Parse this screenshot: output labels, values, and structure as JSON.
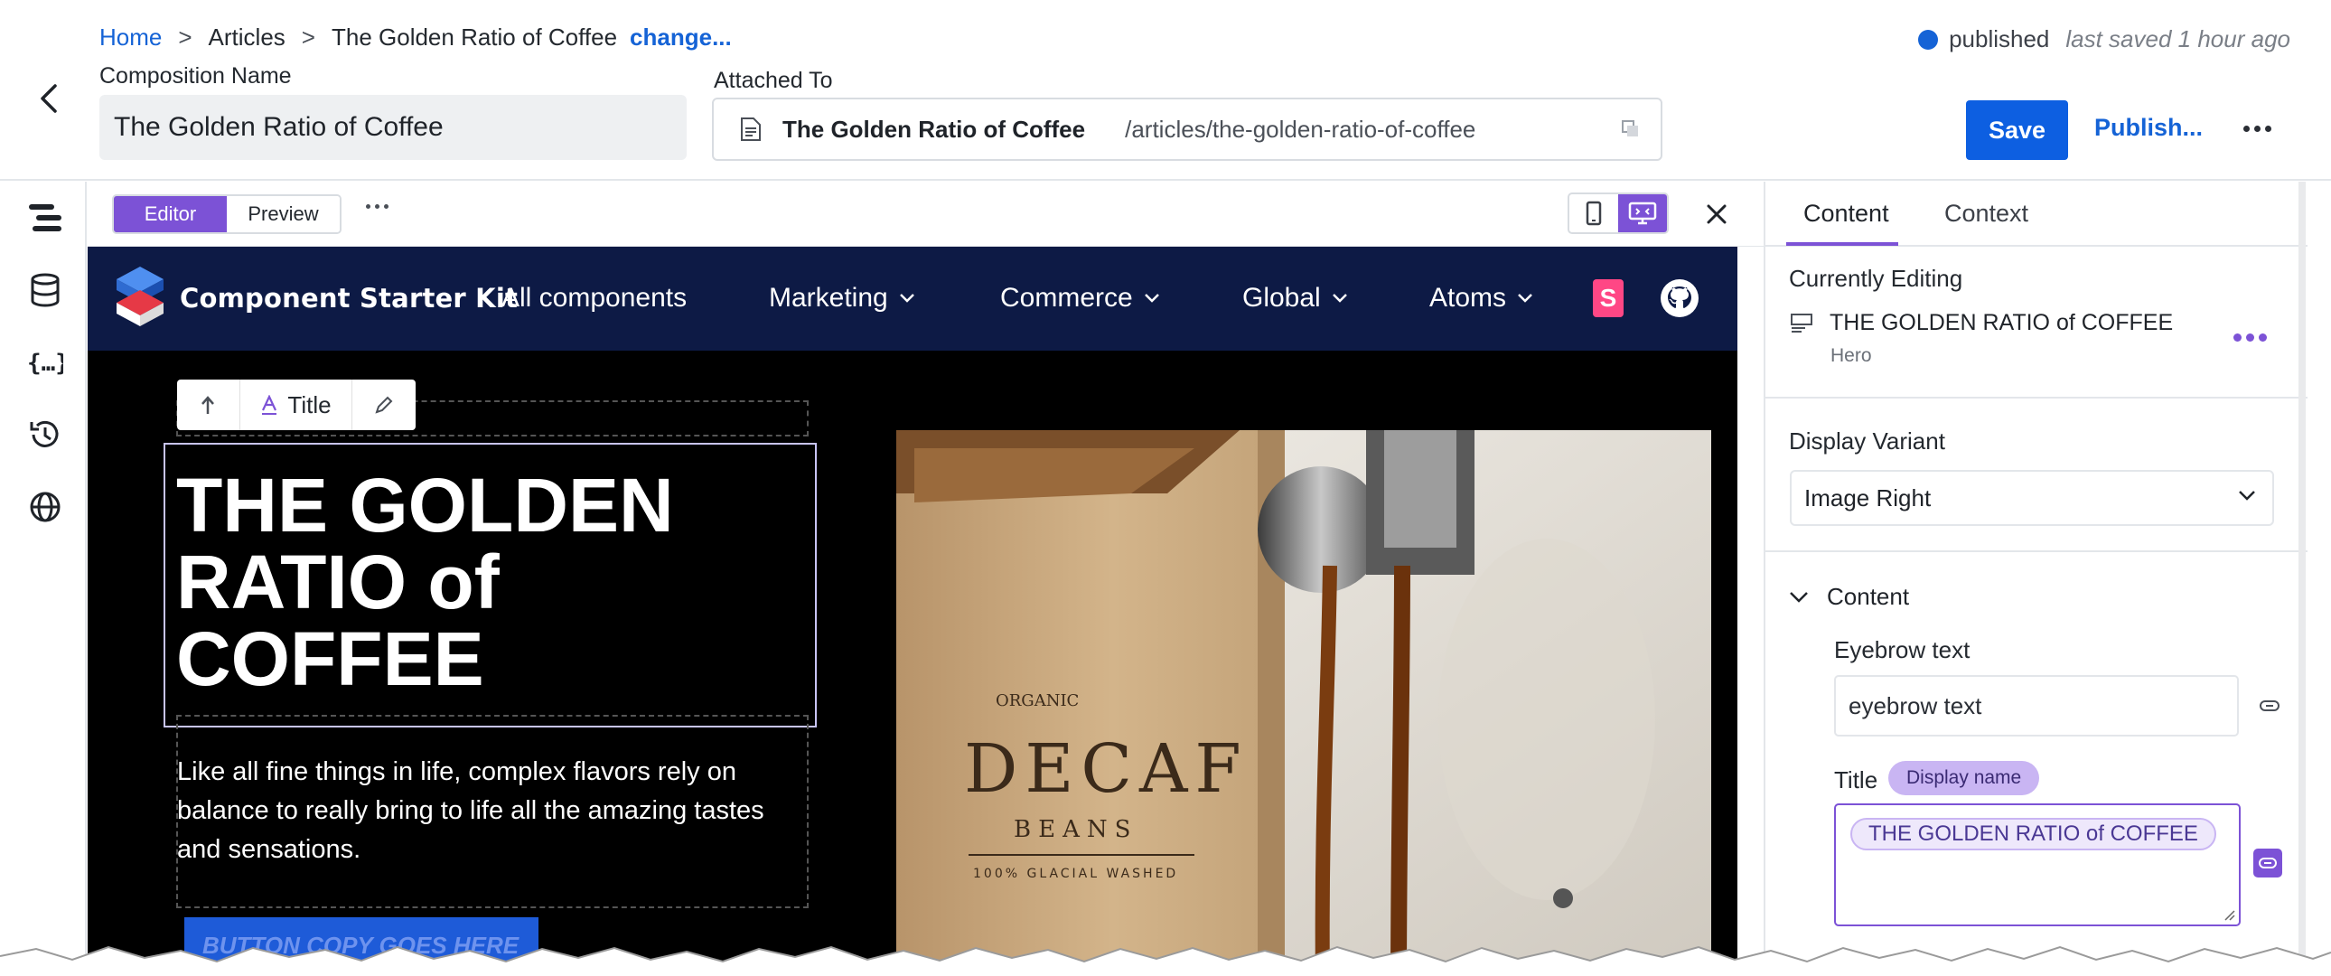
{
  "header": {
    "breadcrumb": {
      "home": "Home",
      "articles": "Articles",
      "current": "The Golden Ratio of Coffee",
      "change": "change...",
      "separator": ">"
    },
    "composition_name_label": "Composition Name",
    "composition_name_value": "The Golden Ratio of Coffee",
    "attached_to_label": "Attached To",
    "attached_title": "The Golden Ratio of Coffee",
    "attached_path": "/articles/the-golden-ratio-of-coffee",
    "status": "published",
    "last_saved": "last saved 1 hour ago",
    "save_label": "Save",
    "publish_label": "Publish..."
  },
  "editor_toolbar": {
    "editor_label": "Editor",
    "preview_label": "Preview"
  },
  "site": {
    "name": "Component Starter Kit",
    "nav": {
      "all": "All components",
      "marketing": "Marketing",
      "commerce": "Commerce",
      "global": "Global",
      "atoms": "Atoms"
    },
    "storybook_letter": "S"
  },
  "float_toolbar": {
    "title_label": "Title"
  },
  "hero": {
    "title": "THE GOLDEN RATIO of COFFEE",
    "description": "Like all fine things in life, complex flavors rely on balance to really bring to life all the amazing tastes and sensations.",
    "cta": "BUTTON COPY GOES HERE",
    "bag_text_top": "ORGANIC",
    "bag_text_main": "DECAF",
    "bag_text_sub": "BEANS",
    "bag_text_bottom": "100% GLACIAL WASHED"
  },
  "panel": {
    "tabs": {
      "content": "Content",
      "context": "Context"
    },
    "currently_editing_label": "Currently Editing",
    "current_component_title": "THE GOLDEN RATIO of COFFEE",
    "current_component_type": "Hero",
    "display_variant_label": "Display Variant",
    "display_variant_value": "Image Right",
    "content_section_label": "Content",
    "eyebrow_label": "Eyebrow text",
    "eyebrow_value": "eyebrow text",
    "title_label": "Title",
    "display_name_badge": "Display name",
    "title_value": "THE GOLDEN RATIO of COFFEE"
  },
  "colors": {
    "accent_purple": "#7c52d6",
    "primary_blue": "#0d5fe1",
    "site_nav_bg": "#0d1a45"
  },
  "icons": [
    "chevron-left-icon",
    "document-icon",
    "copy-icon",
    "layers-icon",
    "database-icon",
    "braces-icon",
    "history-icon",
    "globe-icon",
    "mobile-icon",
    "desktop-icon",
    "close-icon",
    "github-icon",
    "storybook-icon",
    "link-icon",
    "chevron-down-icon"
  ]
}
